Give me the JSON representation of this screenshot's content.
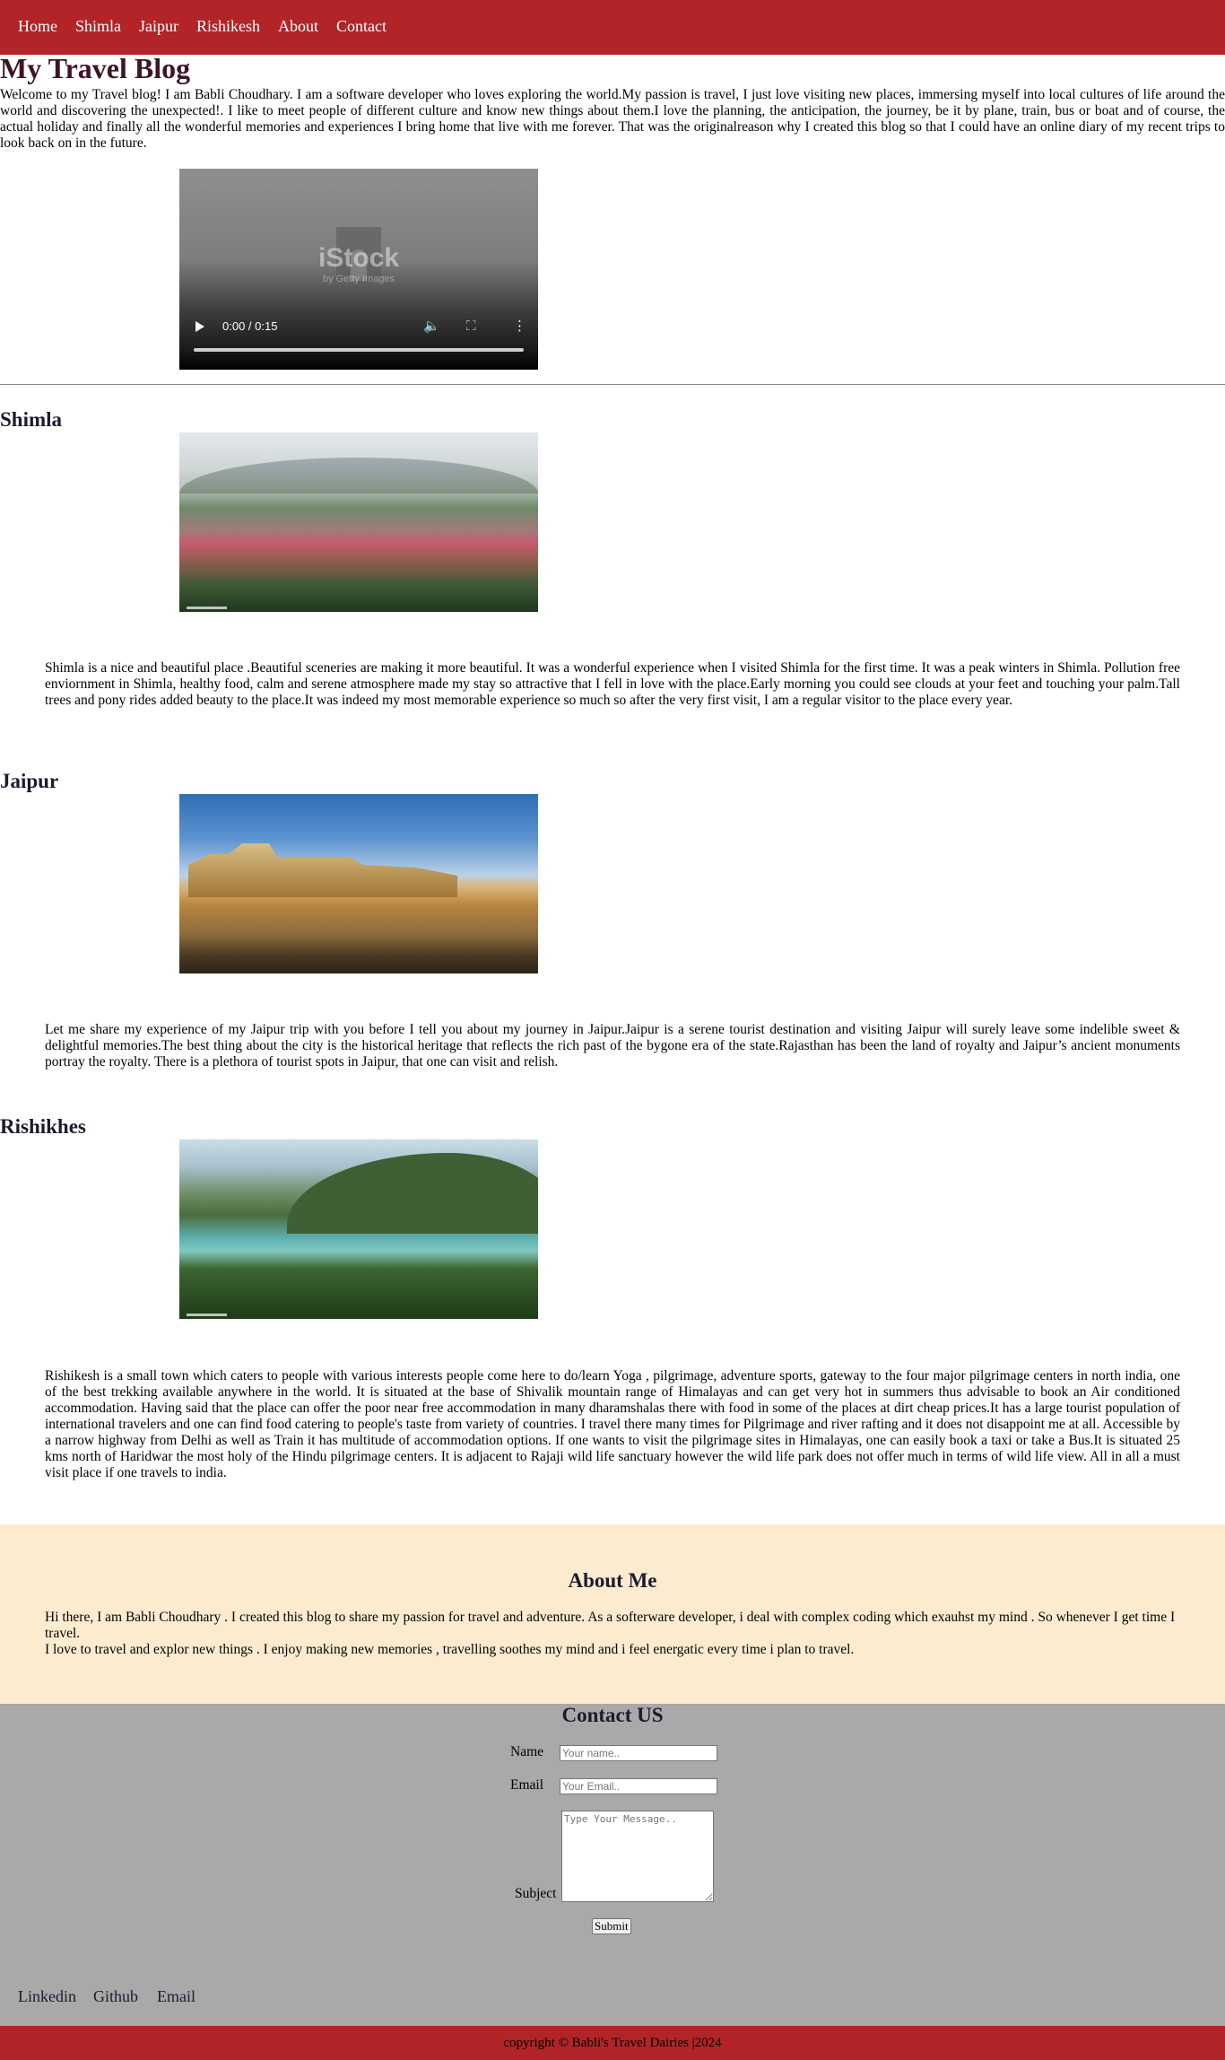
{
  "nav": {
    "items": [
      {
        "label": "Home"
      },
      {
        "label": "Shimla"
      },
      {
        "label": "Jaipur"
      },
      {
        "label": "Rishikesh"
      },
      {
        "label": "About"
      },
      {
        "label": "Contact"
      }
    ]
  },
  "header": {
    "title": "My Travel Blog",
    "intro": "Welcome to my Travel blog! I am Babli Choudhary. I am a software developer who loves exploring the world.My passion is travel, I just love visiting new places, immersing myself into local cultures of life around the world and discovering the unexpected!. I like to meet people of different culture and know new things about them.I love the planning, the anticipation, the journey, be it by plane, train, bus or boat and of course, the actual holiday and finally all the wonderful memories and experiences I bring home that live with me forever. That was the originalreason why I created this blog so that I could have an online diary of my recent trips to look back on in the future."
  },
  "video": {
    "time": "0:00 / 0:15",
    "watermark": "iStock",
    "watermark_sub": "by Getty Images",
    "progress": 0
  },
  "sections": {
    "shimla": {
      "title": "Shimla",
      "text": "Shimla is a nice and beautiful place .Beautiful sceneries are making it more beautiful. It was a wonderful experience when I visited Shimla for the first time. It was a peak winters in Shimla. Pollution free enviornment in Shimla, healthy food, calm and serene atmosphere made my stay so attractive that I fell in love with the place.Early morning you could see clouds at your feet and touching your palm.Tall trees and pony rides added beauty to the place.It was indeed my most memorable experience so much so after the very first visit, I am a regular visitor to the place every year."
    },
    "jaipur": {
      "title": "Jaipur",
      "text": "Let me share my experience of my Jaipur trip with you before I tell you about my journey in Jaipur.Jaipur is a serene tourist destination and visiting Jaipur will surely leave some indelible sweet & delightful memories.The best thing about the city is the historical heritage that reflects the rich past of the bygone era of the state.Rajasthan has been the land of royalty and Jaipur’s ancient monuments portray the royalty. There is a plethora of tourist spots in Jaipur, that one can visit and relish."
    },
    "rishikesh": {
      "title": "Rishikhes",
      "text": "Rishikesh is a small town which caters to people with various interests people come here to do/learn Yoga , pilgrimage, adventure sports, gateway to the four major pilgrimage centers in north india, one of the best trekking available anywhere in the world. It is situated at the base of Shivalik mountain range of Himalayas and can get very hot in summers thus advisable to book an Air conditioned accommodation. Having said that the place can offer the poor near free accommodation in many dharamshalas there with food in some of the places at dirt cheap prices.It has a large tourist population of international travelers and one can find food catering to people's taste from variety of countries. I travel there many times for Pilgrimage and river rafting and it does not disappoint me at all. Accessible by a narrow highway from Delhi as well as Train it has multitude of accommodation options. If one wants to visit the pilgrimage sites in Himalayas, one can easily book a taxi or take a Bus.It is situated 25 kms north of Haridwar the most holy of the Hindu pilgrimage centers. It is adjacent to Rajaji wild life sanctuary however the wild life park does not offer much in terms of wild life view. All in all a must visit place if one travels to india."
    }
  },
  "about": {
    "title": "About Me",
    "line1": "Hi there, I am Babli Choudhary . I created this blog to share my passion for travel and adventure. As a softerware developer, i deal with complex coding which exauhst my mind . So whenever I get time I travel.",
    "line2": "I love to travel and explor new things . I enjoy making new memories , travelling soothes my mind and i feel energatic every time i plan to travel."
  },
  "contact": {
    "title": "Contact US",
    "name_label": "Name",
    "name_placeholder": "Your name..",
    "email_label": "Email",
    "email_placeholder": "Your Email..",
    "subject_label": "Subject",
    "message_placeholder": "Type Your Message..",
    "submit_label": "Submit"
  },
  "social": {
    "items": [
      {
        "label": "Linkedin"
      },
      {
        "label": "Github"
      },
      {
        "label": "Email"
      }
    ]
  },
  "footer": {
    "copyright": "copyright © Babli's Travel Dairies |2024"
  },
  "colors": {
    "brand_red": "#b22427",
    "about_bg": "#fdebd0",
    "contact_bg": "#a9a9a9"
  },
  "icons": [
    "play-icon",
    "volume-icon",
    "fullscreen-icon",
    "more-options-icon"
  ]
}
